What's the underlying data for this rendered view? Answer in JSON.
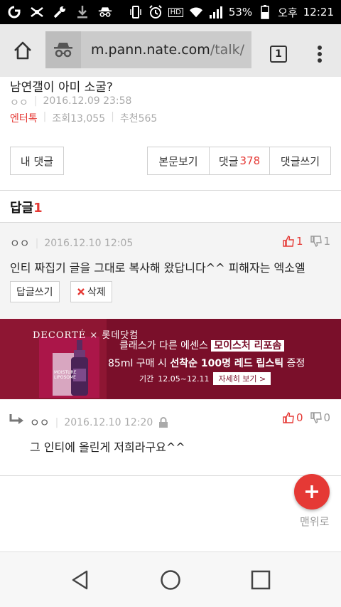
{
  "status_bar": {
    "battery": "53%",
    "ampm": "오후",
    "time": "12:21",
    "hd": "HD"
  },
  "browser": {
    "url_host": "m.pann.nate.com",
    "url_path": "/talk/",
    "tab_count": "1"
  },
  "article": {
    "title": "남연갤이 아미 소굴?",
    "author": "ㅇㅇ",
    "datetime": "2016.12.09 23:58",
    "category": "엔터톡",
    "views": "조회13,055",
    "recommend": "추천565"
  },
  "buttons": {
    "my_comments": "내 댓글",
    "view_post": "본문보기",
    "comments_label": "댓글",
    "comments_count": "378",
    "write_comment": "댓글쓰기"
  },
  "replies": {
    "label": "답글",
    "count": "1"
  },
  "comment1": {
    "author": "ㅇㅇ",
    "datetime": "2016.12.10 12:05",
    "up": "1",
    "down": "1",
    "text": "인티 짜집기 글을 그대로 복사해 왔답니다^^ 피해자는 엑소엘",
    "reply_button": "답글쓰기",
    "delete_button": "삭제"
  },
  "ad": {
    "brand": "DECORTÉ × 롯데닷컴",
    "line1_pre": "클래스가 다른 에센스",
    "line1_hl": "모이스처 리포솜",
    "line2_pre": "85ml 구매 시",
    "line2_hl": "선착순 100명 레드 립스틱",
    "line2_post": "증정",
    "period_label": "기간",
    "period": "12.05~12.11",
    "more": "자세히 보기 >",
    "bottle_label": "MOISTURE LIPOSOME",
    "color": "#7a0f2a"
  },
  "comment2": {
    "author": "ㅇㅇ",
    "datetime": "2016.12.10 12:20",
    "up": "0",
    "down": "0",
    "text": "그 인티에 올린게 저희라구요^^"
  },
  "fab": {
    "top_label": "맨위로"
  },
  "colors": {
    "accent": "#e53935"
  }
}
